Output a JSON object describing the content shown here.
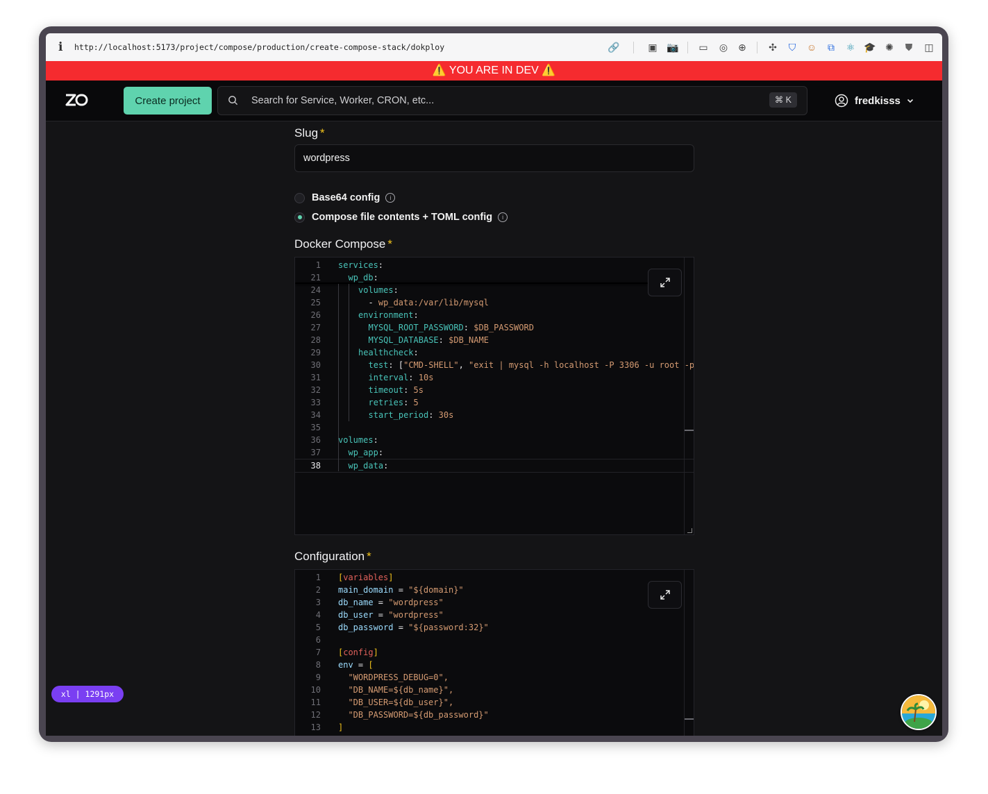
{
  "browser": {
    "url": "http://localhost:5173/project/compose/production/create-compose-stack/dokploy"
  },
  "dev_banner": {
    "text": "⚠️ YOU ARE IN DEV ⚠️"
  },
  "header": {
    "logo_text": "ZO",
    "create_project_label": "Create project",
    "search_placeholder": "Search for Service, Worker, CRON, etc...",
    "search_shortcut": "⌘ K",
    "username": "fredkisss"
  },
  "form": {
    "slug": {
      "label": "Slug",
      "required_mark": "*",
      "value": "wordpress"
    },
    "config_mode": {
      "options": [
        {
          "label": "Base64 config",
          "selected": false
        },
        {
          "label": "Compose file contents + TOML config",
          "selected": true
        }
      ]
    },
    "docker_compose": {
      "label": "Docker Compose",
      "required_mark": "*",
      "lines": [
        {
          "n": "1",
          "indent": 0,
          "key": "services",
          "val": "",
          "cls": "k"
        },
        {
          "n": "21",
          "indent": 1,
          "key": "wp_db",
          "val": "",
          "cls": "k"
        },
        {
          "n": "24",
          "indent": 2,
          "key": "volumes",
          "val": "",
          "cls": "k"
        },
        {
          "n": "25",
          "indent": 2,
          "key": "",
          "val": "  - wp_data:/var/lib/mysql",
          "cls": "v"
        },
        {
          "n": "26",
          "indent": 2,
          "key": "environment",
          "val": "",
          "cls": "k"
        },
        {
          "n": "27",
          "indent": 3,
          "key": "MYSQL_ROOT_PASSWORD",
          "val": " $DB_PASSWORD",
          "cls": "k"
        },
        {
          "n": "28",
          "indent": 3,
          "key": "MYSQL_DATABASE",
          "val": " $DB_NAME",
          "cls": "k"
        },
        {
          "n": "29",
          "indent": 2,
          "key": "healthcheck",
          "val": "",
          "cls": "k"
        },
        {
          "n": "30",
          "indent": 3,
          "key": "test",
          "val": " [\"CMD-SHELL\", \"exit | mysql -h localhost -P 3306 -u root -p",
          "cls": "k"
        },
        {
          "n": "31",
          "indent": 3,
          "key": "interval",
          "val": " 10s",
          "cls": "k"
        },
        {
          "n": "32",
          "indent": 3,
          "key": "timeout",
          "val": " 5s",
          "cls": "k"
        },
        {
          "n": "33",
          "indent": 3,
          "key": "retries",
          "val": " 5",
          "cls": "k"
        },
        {
          "n": "34",
          "indent": 3,
          "key": "start_period",
          "val": " 30s",
          "cls": "k"
        },
        {
          "n": "35",
          "indent": 0,
          "key": "",
          "val": "",
          "cls": "k"
        },
        {
          "n": "36",
          "indent": 0,
          "key": "volumes",
          "val": "",
          "cls": "k"
        },
        {
          "n": "37",
          "indent": 1,
          "key": "wp_app",
          "val": "",
          "cls": "k"
        },
        {
          "n": "38",
          "indent": 1,
          "key": "wp_data",
          "val": "",
          "cls": "k"
        }
      ]
    },
    "configuration": {
      "label": "Configuration",
      "required_mark": "*",
      "lines": [
        {
          "n": "1",
          "text": "[variables]",
          "type": "section"
        },
        {
          "n": "2",
          "key": "main_domain",
          "val": "\"${domain}\""
        },
        {
          "n": "3",
          "key": "db_name",
          "val": "\"wordpress\""
        },
        {
          "n": "4",
          "key": "db_user",
          "val": "\"wordpress\""
        },
        {
          "n": "5",
          "key": "db_password",
          "val": "\"${password:32}\""
        },
        {
          "n": "6",
          "text": "",
          "type": "blank"
        },
        {
          "n": "7",
          "text": "[config]",
          "type": "section"
        },
        {
          "n": "8",
          "key": "env",
          "val": "[",
          "type": "arr"
        },
        {
          "n": "9",
          "text": "  \"WORDPRESS_DEBUG=0\",",
          "type": "str"
        },
        {
          "n": "10",
          "text": "  \"DB_NAME=${db_name}\",",
          "type": "str"
        },
        {
          "n": "11",
          "text": "  \"DB_USER=${db_user}\",",
          "type": "str"
        },
        {
          "n": "12",
          "text": "  \"DB_PASSWORD=${db_password}\"",
          "type": "str"
        },
        {
          "n": "13",
          "text": "]",
          "type": "close"
        }
      ]
    }
  },
  "breakpoint_badge": "xl | 1291px"
}
